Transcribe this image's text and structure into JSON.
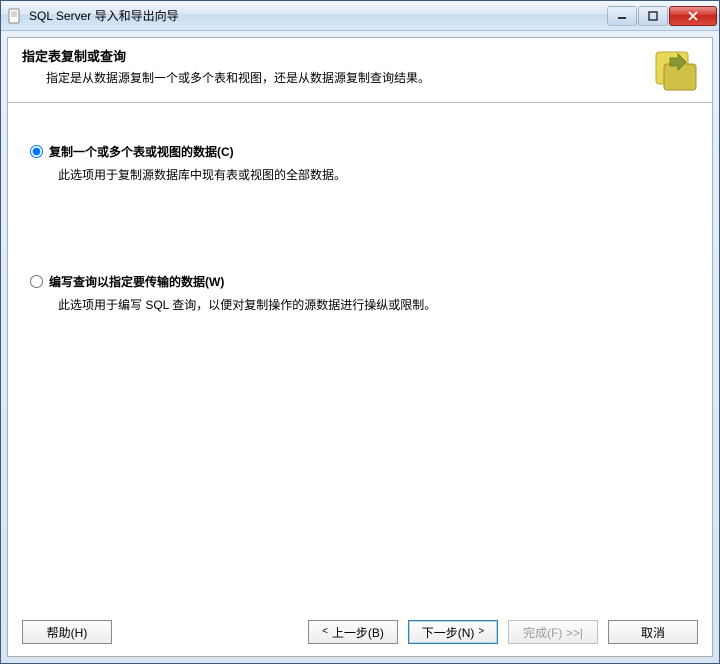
{
  "window": {
    "title": "SQL Server 导入和导出向导"
  },
  "header": {
    "title": "指定表复制或查询",
    "description": "指定是从数据源复制一个或多个表和视图，还是从数据源复制查询结果。"
  },
  "options": {
    "copy": {
      "label": "复制一个或多个表或视图的数据(C)",
      "description": "此选项用于复制源数据库中现有表或视图的全部数据。",
      "selected": true
    },
    "query": {
      "label": "编写查询以指定要传输的数据(W)",
      "description": "此选项用于编写 SQL 查询，以便对复制操作的源数据进行操纵或限制。",
      "selected": false
    }
  },
  "buttons": {
    "help": "帮助(H)",
    "back": "上一步(B)",
    "next": "下一步(N)",
    "finish": "完成(F) >>|",
    "cancel": "取消"
  }
}
